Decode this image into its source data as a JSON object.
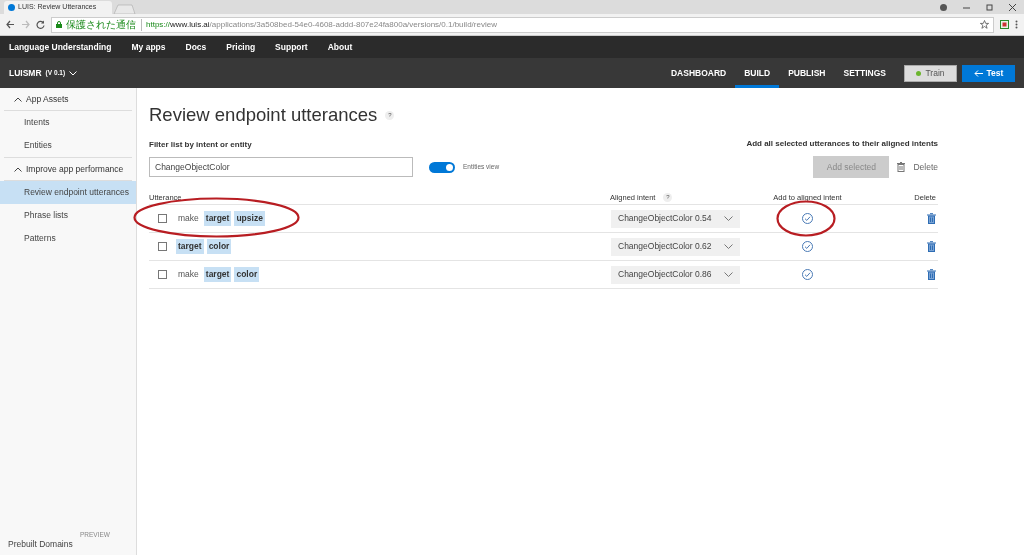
{
  "browser": {
    "tab_title": "LUIS: Review Utterances",
    "secure_label": "保護された通信",
    "url_scheme": "https://",
    "url_host": "www.luis.ai",
    "url_path": "/applications/3a508bed-54e0-4608-addd-807e24fa800a/versions/0.1/build/review"
  },
  "top_nav": [
    "Language Understanding",
    "My apps",
    "Docs",
    "Pricing",
    "Support",
    "About"
  ],
  "app": {
    "name": "LUISMR",
    "version": "(V 0.1)"
  },
  "app_tabs": [
    {
      "label": "DASHBOARD",
      "selected": false
    },
    {
      "label": "BUILD",
      "selected": true
    },
    {
      "label": "PUBLISH",
      "selected": false
    },
    {
      "label": "SETTINGS",
      "selected": false
    }
  ],
  "train_button": "Train",
  "test_button": "Test",
  "sidebar": {
    "groups": [
      {
        "label": "App Assets",
        "expanded": true,
        "items": [
          {
            "label": "Intents",
            "selected": false
          },
          {
            "label": "Entities",
            "selected": false
          }
        ]
      },
      {
        "label": "Improve app performance",
        "expanded": true,
        "items": [
          {
            "label": "Review endpoint utterances",
            "selected": true
          },
          {
            "label": "Phrase lists",
            "selected": false
          },
          {
            "label": "Patterns",
            "selected": false
          }
        ]
      }
    ],
    "footer": {
      "label": "Prebuilt Domains",
      "badge": "PREVIEW"
    }
  },
  "page": {
    "title": "Review endpoint utterances",
    "help": "?",
    "filter_label": "Filter list by intent or entity",
    "filter_value": "ChangeObjectColor",
    "entities_view": {
      "label": "Entities view",
      "on": true
    },
    "bulk_label": "Add all selected utterances to their aligned intents",
    "add_selected": {
      "label": "Add selected",
      "disabled": true
    },
    "delete_label": "Delete"
  },
  "table": {
    "columns": [
      "Utterance",
      "Aligned intent",
      "Add to aligned intent",
      "Delete"
    ],
    "aligned_help": "?",
    "rows": [
      {
        "checked": false,
        "tokens": [
          {
            "text": "make",
            "entity": false
          },
          {
            "text": "target",
            "entity": true
          },
          {
            "text": "upsize",
            "entity": true
          }
        ],
        "intent": "ChangeObjectColor 0.54",
        "utterance_circled": true,
        "add_circled": true
      },
      {
        "checked": false,
        "tokens": [
          {
            "text": "target",
            "entity": true
          },
          {
            "text": "color",
            "entity": true
          }
        ],
        "intent": "ChangeObjectColor 0.62"
      },
      {
        "checked": false,
        "tokens": [
          {
            "text": "make",
            "entity": false
          },
          {
            "text": "target",
            "entity": true
          },
          {
            "text": "color",
            "entity": true
          }
        ],
        "intent": "ChangeObjectColor 0.86"
      }
    ]
  }
}
